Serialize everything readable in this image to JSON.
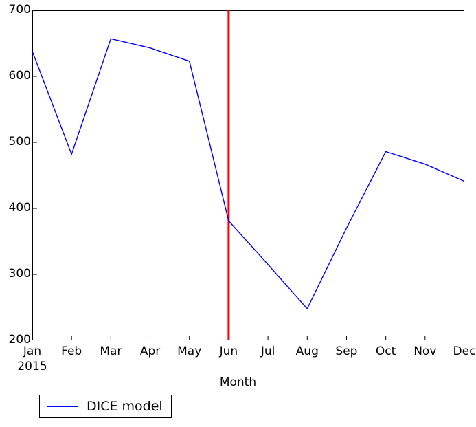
{
  "chart_data": {
    "type": "line",
    "title": "",
    "xlabel": "Month",
    "ylabel": "",
    "categories": [
      "Jan",
      "Feb",
      "Mar",
      "Apr",
      "May",
      "Jun",
      "Jul",
      "Aug",
      "Sep",
      "Oct",
      "Nov",
      "Dec"
    ],
    "x_sublabel": "2015",
    "series": [
      {
        "name": "DICE model",
        "color": "#0000ff",
        "values": [
          638,
          482,
          657,
          643,
          623,
          381,
          315,
          248,
          370,
          486,
          467,
          441
        ]
      }
    ],
    "ylim": [
      200,
      700
    ],
    "yticks": [
      200,
      300,
      400,
      500,
      600,
      700
    ],
    "ytick_labels": [
      "200",
      "300",
      "400",
      "500",
      "600",
      "700"
    ],
    "xlim": [
      0,
      11
    ],
    "grid": false,
    "legend": {
      "position": "below-left",
      "entries": [
        {
          "label": "DICE model",
          "color": "#0000ff"
        }
      ]
    },
    "annotations": [
      {
        "type": "vertical-line",
        "name": "june-marker",
        "x_category": "Jun",
        "x_index": 5,
        "color": "#ff0000",
        "linewidth": 3
      }
    ]
  }
}
